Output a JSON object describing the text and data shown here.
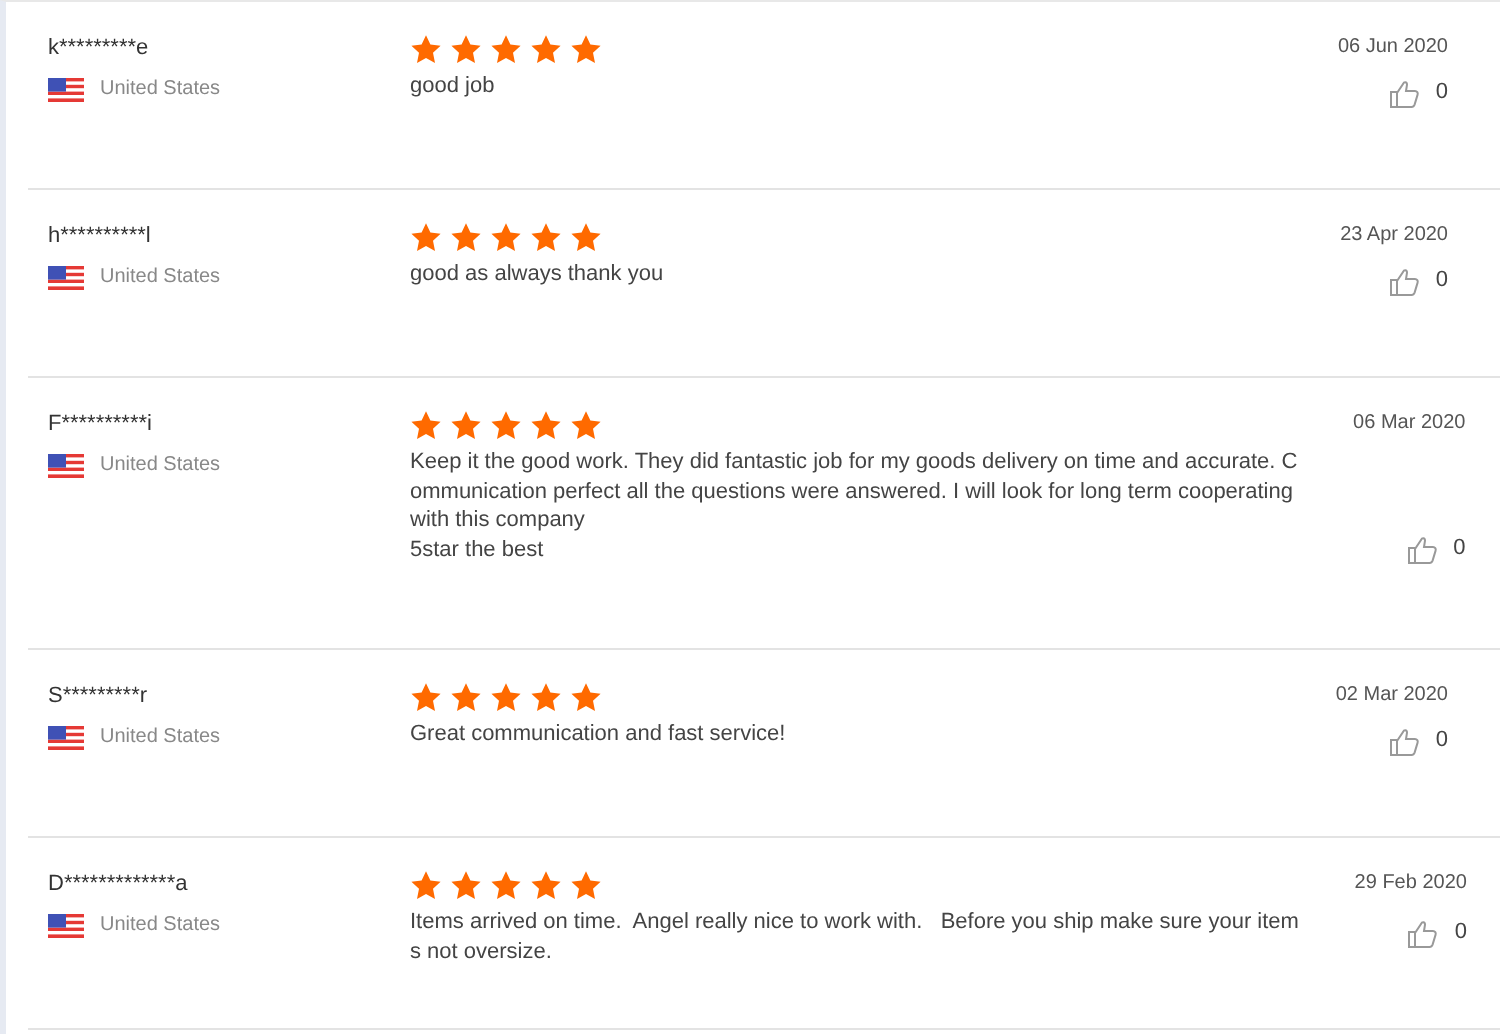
{
  "reviews": [
    {
      "name": "k*********e",
      "country": "United States",
      "stars": 5,
      "comment": [
        "good job"
      ],
      "date": "06 Jun 2020",
      "likes": "0"
    },
    {
      "name": "h**********l",
      "country": "United States",
      "stars": 5,
      "comment": [
        "good as always thank you"
      ],
      "date": "23 Apr 2020",
      "likes": "0"
    },
    {
      "name": "F**********i",
      "country": "United States",
      "stars": 5,
      "comment": [
        "Keep it the good work. They did fantastic job for my goods delivery on time and accurate. C",
        "ommunication perfect all the questions were answered. I will look for long term cooperating",
        "with this company",
        "5star the best"
      ],
      "date": "06 Mar 2020",
      "likes": "0"
    },
    {
      "name": "S*********r",
      "country": "United States",
      "stars": 5,
      "comment": [
        "Great communication and fast service!"
      ],
      "date": "02 Mar 2020",
      "likes": "0"
    },
    {
      "name": "D*************a",
      "country": "United States",
      "stars": 5,
      "comment": [
        "Items arrived on time.  Angel really nice to work with.   Before you ship make sure your item",
        "s not oversize."
      ],
      "date": "29 Feb 2020",
      "likes": "0"
    }
  ]
}
